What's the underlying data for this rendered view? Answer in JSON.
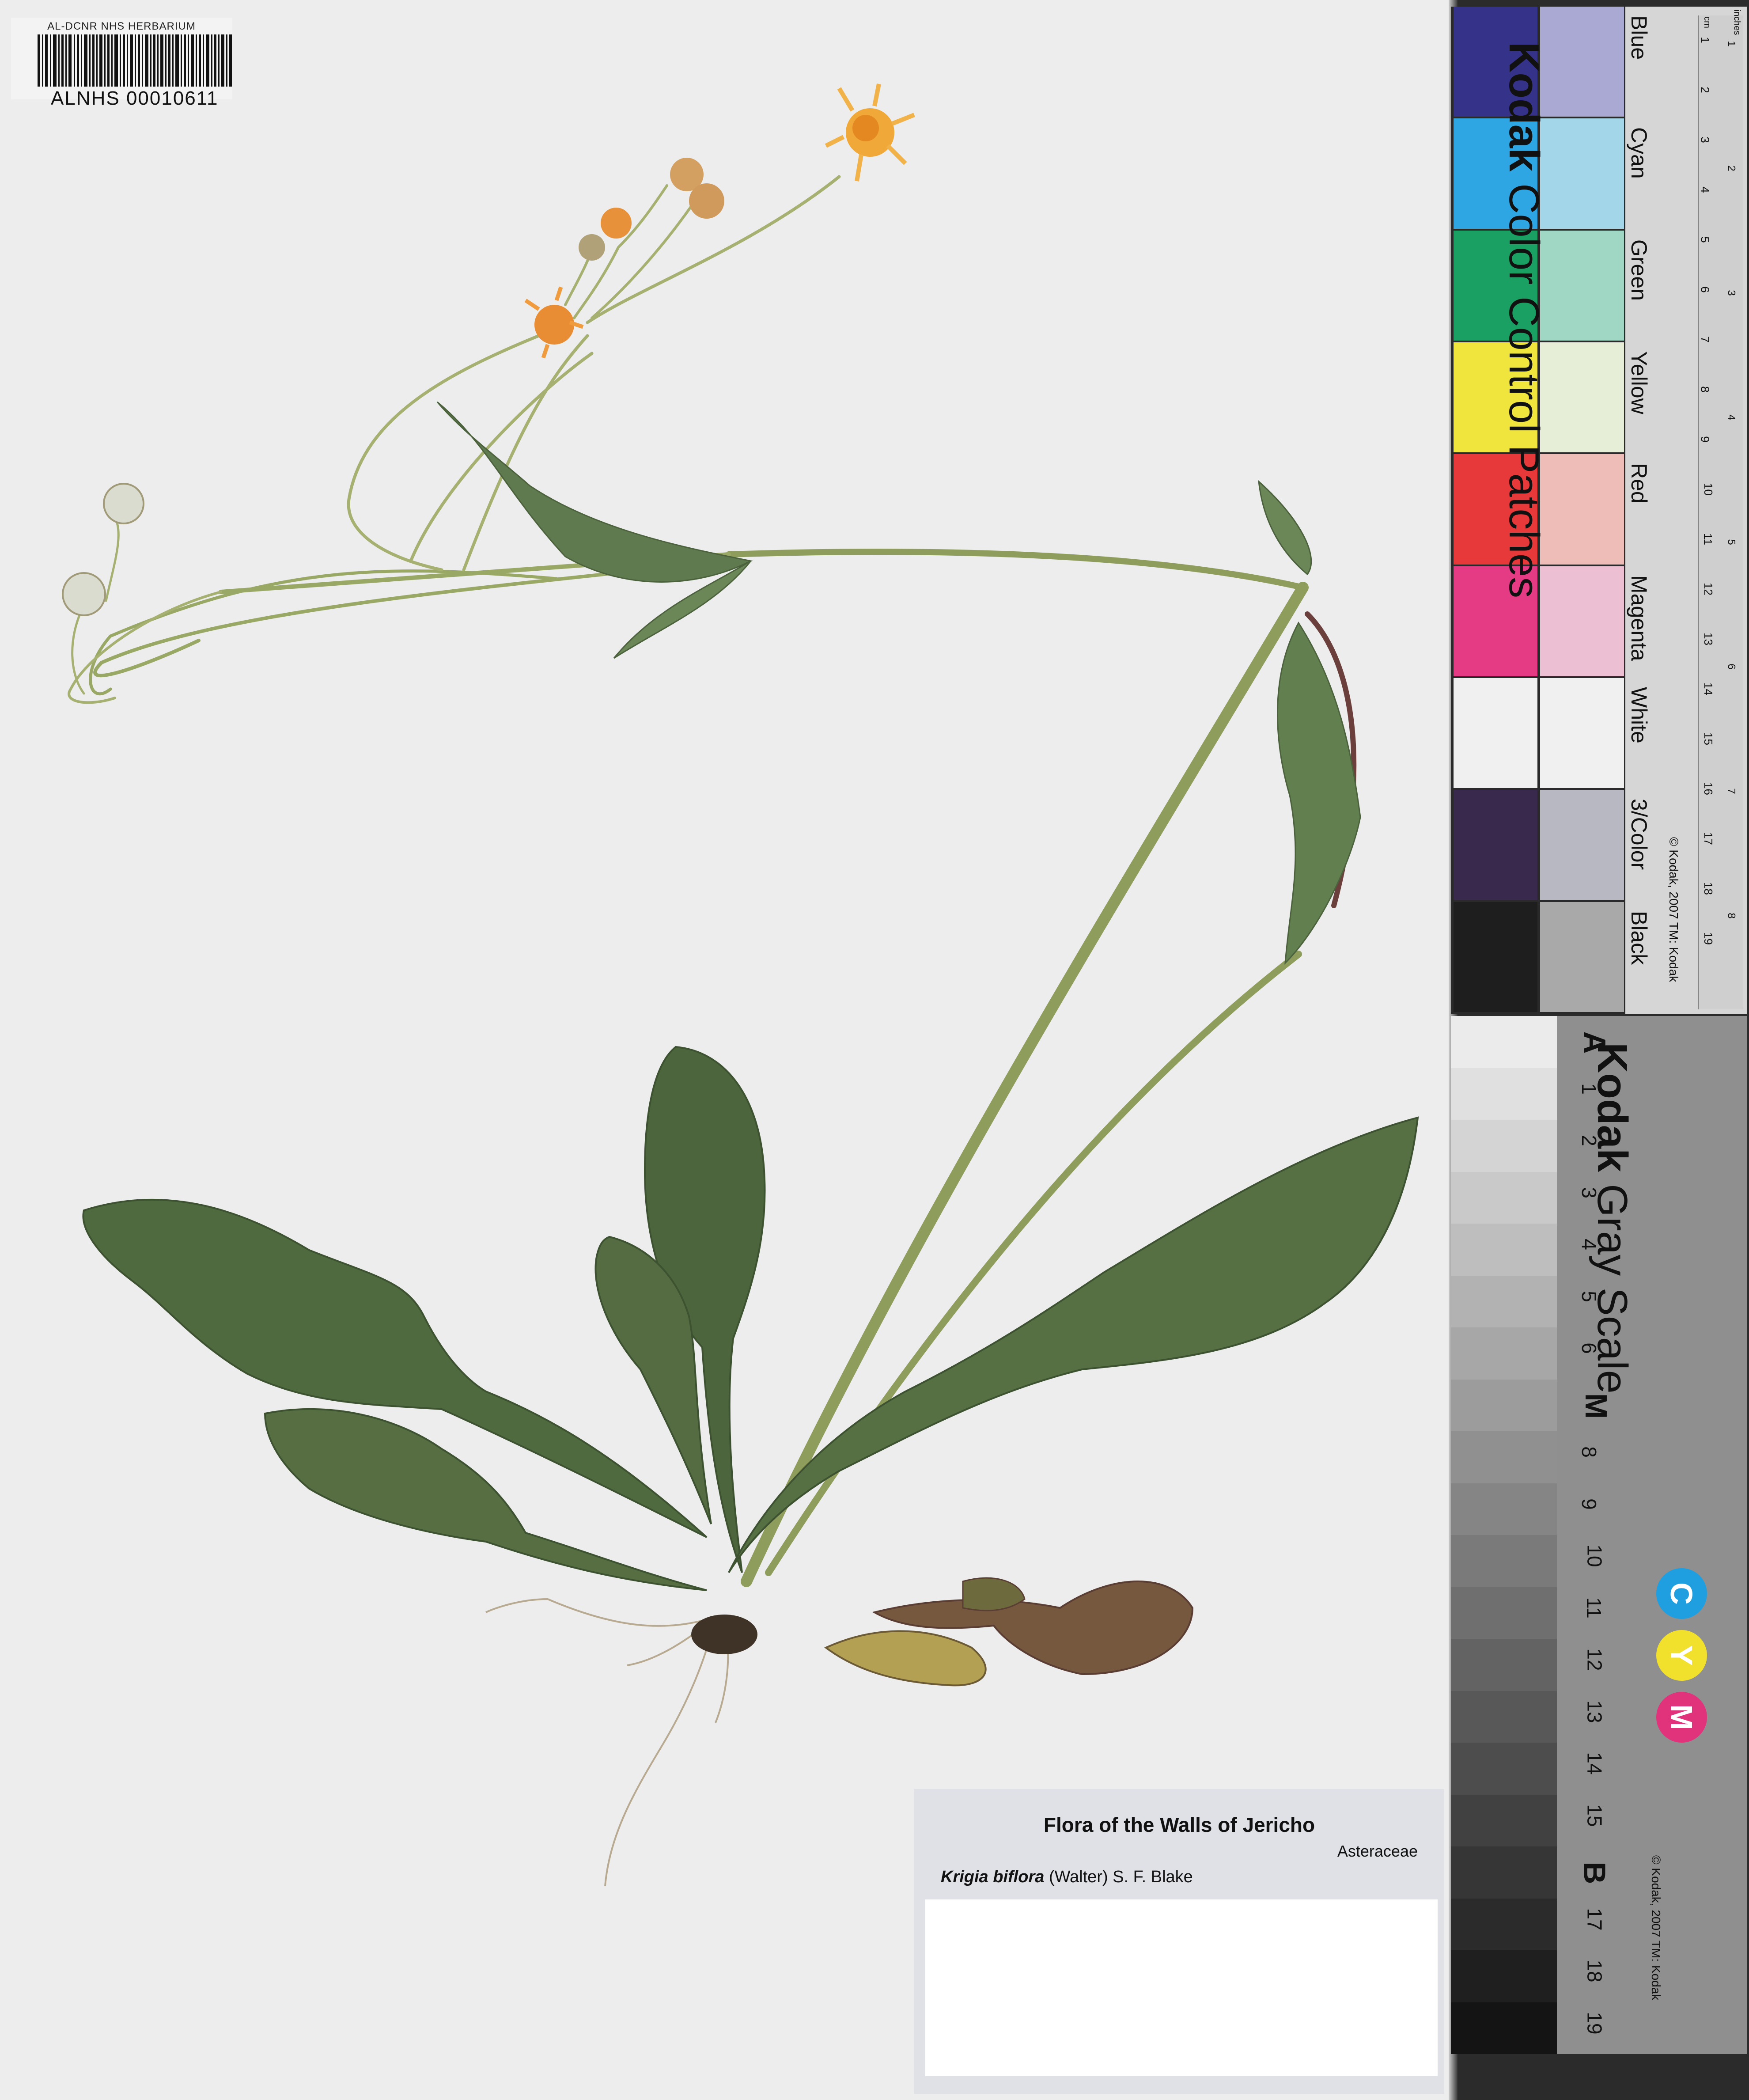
{
  "barcode": {
    "header": "AL-DCNR NHS HERBARIUM",
    "number": "ALNHS 00010611"
  },
  "label": {
    "title": "Flora of  the Walls of Jericho",
    "family": "Asteraceae",
    "genus_species": "Krigia biflora",
    "authority": "(Walter) S. F. Blake"
  },
  "color_card": {
    "brand": "Kodak",
    "title": "Color Control Patches",
    "copyright": "© Kodak, 2007 TM: Kodak",
    "patches": [
      {
        "name": "Blue",
        "dark": "#35328a",
        "light": "#a9a9d3"
      },
      {
        "name": "Cyan",
        "dark": "#2ea6e4",
        "light": "#a4d6ea"
      },
      {
        "name": "Green",
        "dark": "#1aa062",
        "light": "#9fd7c4"
      },
      {
        "name": "Yellow",
        "dark": "#f0e53c",
        "light": "#e6eed8"
      },
      {
        "name": "Red",
        "dark": "#e8393a",
        "light": "#eebdb8"
      },
      {
        "name": "Magenta",
        "dark": "#e53b85",
        "light": "#ecbfd3"
      },
      {
        "name": "White",
        "dark": "#f0f0f0",
        "light": "#f0f0f0"
      },
      {
        "name": "3/Color",
        "dark": "#392a4d",
        "light": "#b8b8c2"
      },
      {
        "name": "Black",
        "dark": "#1e1e1e",
        "light": "#a9a9a9"
      }
    ],
    "ruler_units": [
      "cm",
      "inches"
    ],
    "cm_ticks": [
      "1",
      "2",
      "3",
      "4",
      "5",
      "6",
      "7",
      "8",
      "9",
      "10",
      "11",
      "12",
      "13",
      "14",
      "15",
      "16",
      "17",
      "18",
      "19"
    ],
    "inch_ticks": [
      "1",
      "2",
      "3",
      "4",
      "5",
      "6",
      "7",
      "8"
    ]
  },
  "gray_card": {
    "brand": "Kodak",
    "title": "Gray Scale",
    "copyright": "© Kodak, 2007 TM: Kodak",
    "steps": [
      "A",
      "1",
      "2",
      "3",
      "4",
      "5",
      "6",
      "M",
      "8",
      "9",
      "10",
      "11",
      "12",
      "13",
      "14",
      "15",
      "B",
      "17",
      "18",
      "19"
    ],
    "cym": [
      {
        "letter": "C",
        "color": "#1f9ee0"
      },
      {
        "letter": "Y",
        "color": "#f1e12c"
      },
      {
        "letter": "M",
        "color": "#e1327c"
      }
    ]
  }
}
